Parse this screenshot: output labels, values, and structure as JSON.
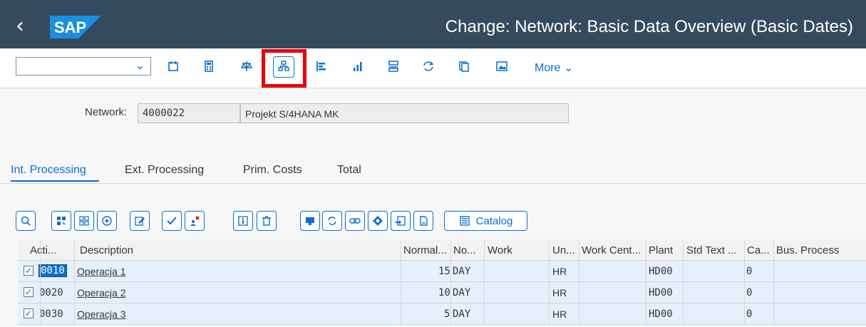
{
  "shell": {
    "back_label": "‹",
    "logo": "SAP",
    "title": "Change: Network: Basic Data Overview (Basic Dates)"
  },
  "toolbar": {
    "command_value": "",
    "more_label": "More",
    "icons": [
      "calendar-icon",
      "calculator-icon",
      "balance-icon",
      "hierarchy-icon",
      "bar-align-icon",
      "chart-icon",
      "list-icon",
      "sync-icon",
      "copy-icon",
      "image-icon"
    ]
  },
  "network": {
    "label": "Network:",
    "number": "4000022",
    "description": "Projekt S/4HANA MK"
  },
  "tabs": [
    "Int. Processing",
    "Ext. Processing",
    "Prim. Costs",
    "Total"
  ],
  "grid_toolbar": {
    "catalog_label": "Catalog"
  },
  "table": {
    "headers": [
      "Acti...",
      "Description",
      "Normal...",
      "No...",
      "Work",
      "Un...",
      "Work Cent...",
      "Plant",
      "Std Text ...",
      "Ca...",
      "Bus. Process"
    ],
    "rows": [
      {
        "check": "✓",
        "activity": "0010",
        "description": "Operacja 1",
        "normal": "15",
        "unit": "DAY",
        "work": "",
        "work_unit": "HR",
        "work_center": "",
        "plant": "HD00",
        "std_text": "",
        "calc": "0",
        "bus_process": ""
      },
      {
        "check": "✓",
        "activity": "0020",
        "description": "Operacja 2",
        "normal": "10",
        "unit": "DAY",
        "work": "",
        "work_unit": "HR",
        "work_center": "",
        "plant": "HD00",
        "std_text": "",
        "calc": "0",
        "bus_process": ""
      },
      {
        "check": "✓",
        "activity": "0030",
        "description": "Operacja 3",
        "normal": "5",
        "unit": "DAY",
        "work": "",
        "work_unit": "HR",
        "work_center": "",
        "plant": "HD00",
        "std_text": "",
        "calc": "0",
        "bus_process": ""
      }
    ]
  },
  "colors": {
    "shell": "#354a5f",
    "accent": "#0a6ed1",
    "highlight": "#e8000b"
  }
}
